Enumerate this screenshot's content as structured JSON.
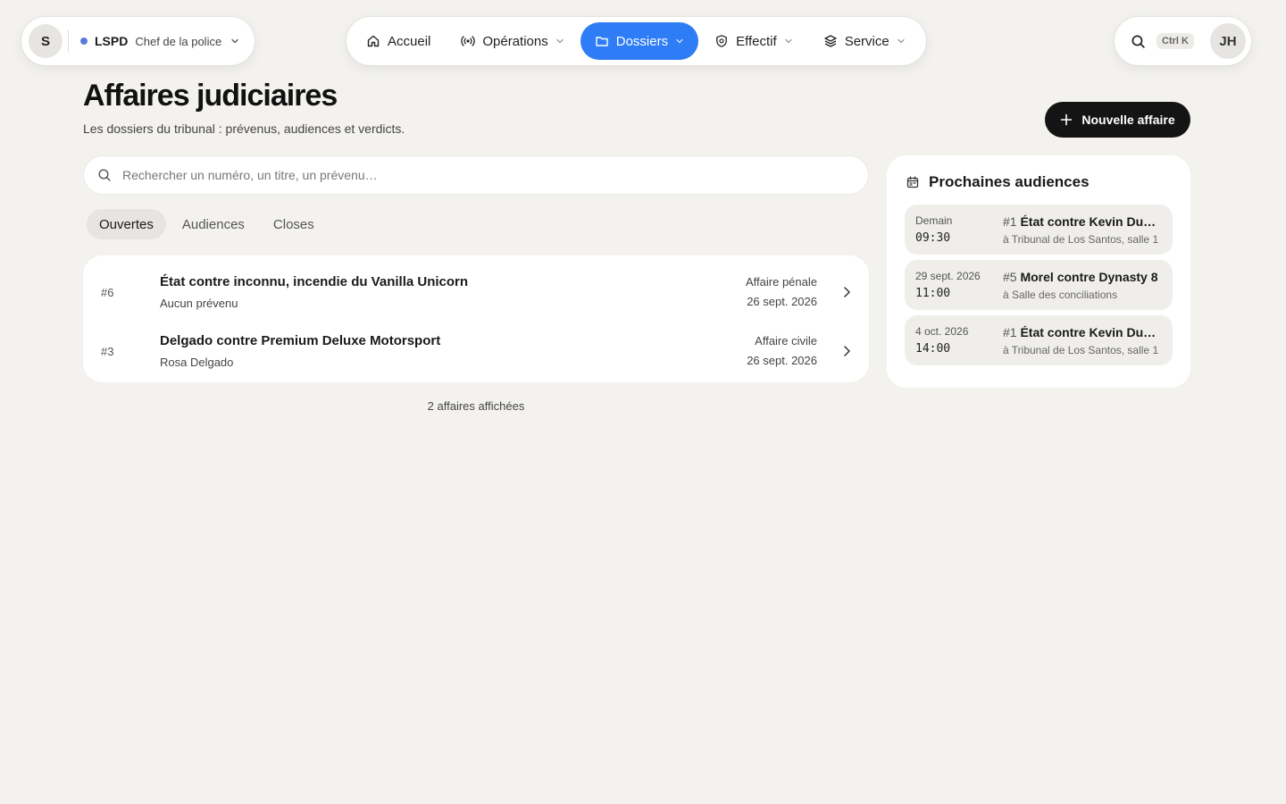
{
  "org": {
    "avatar": "S",
    "name": "LSPD",
    "role": "Chef de la police",
    "status_color": "#5b7bdb"
  },
  "nav": {
    "items": [
      {
        "label": "Accueil",
        "icon": "home-icon"
      },
      {
        "label": "Opérations",
        "icon": "broadcast-icon"
      },
      {
        "label": "Dossiers",
        "icon": "folder-icon",
        "active": true
      },
      {
        "label": "Effectif",
        "icon": "shield-icon"
      },
      {
        "label": "Service",
        "icon": "layers-icon"
      }
    ],
    "active_color": "#2e7cf6"
  },
  "toolbar": {
    "shortcut": "Ctrl K",
    "user_initials": "JH"
  },
  "page": {
    "title": "Affaires judiciaires",
    "subtitle": "Les dossiers du tribunal : prévenus, audiences et verdicts.",
    "new_button": "Nouvelle affaire"
  },
  "search": {
    "placeholder": "Rechercher un numéro, un titre, un prévenu…",
    "value": ""
  },
  "tabs": [
    {
      "label": "Ouvertes",
      "active": true
    },
    {
      "label": "Audiences"
    },
    {
      "label": "Closes"
    }
  ],
  "cases": [
    {
      "num": "#6",
      "title": "État contre inconnu, incendie du Vanilla Unicorn",
      "defendant": "Aucun prévenu",
      "type": "Affaire pénale",
      "date": "26 sept. 2026"
    },
    {
      "num": "#3",
      "title": "Delgado contre Premium Deluxe Motorsport",
      "defendant": "Rosa Delgado",
      "type": "Affaire civile",
      "date": "26 sept. 2026"
    }
  ],
  "count_label": "2 affaires affichées",
  "hearings": {
    "title": "Prochaines audiences",
    "items": [
      {
        "date": "Demain",
        "time": "09:30",
        "num": "#1",
        "title": "État contre Kevin Duarte",
        "place": "à Tribunal de Los Santos, salle 1"
      },
      {
        "date": "29 sept. 2026",
        "time": "11:00",
        "num": "#5",
        "title": "Morel contre Dynasty 8",
        "place": "à Salle des conciliations"
      },
      {
        "date": "4 oct. 2026",
        "time": "14:00",
        "num": "#1",
        "title": "État contre Kevin Duarte",
        "place": "à Tribunal de Los Santos, salle 1"
      }
    ]
  }
}
